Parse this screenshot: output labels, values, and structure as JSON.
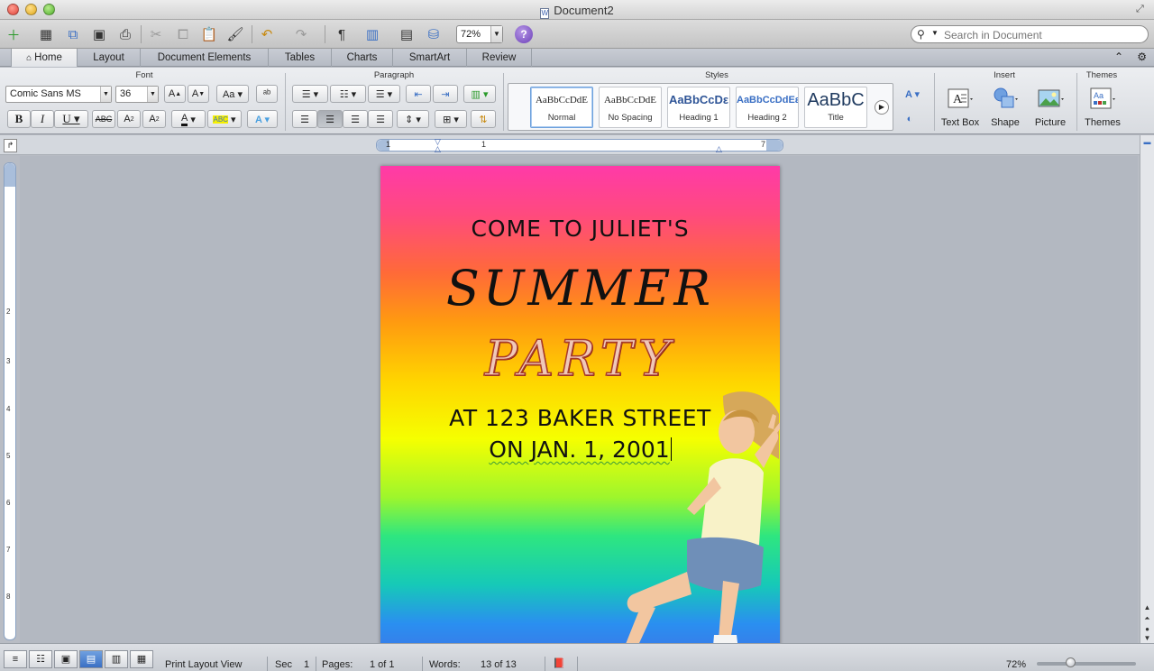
{
  "window": {
    "title": "Document2"
  },
  "toolbar": {
    "zoom": "72%",
    "search_placeholder": "Search in Document"
  },
  "ribbon_tabs": [
    "Home",
    "Layout",
    "Document Elements",
    "Tables",
    "Charts",
    "SmartArt",
    "Review"
  ],
  "ribbon": {
    "groups": {
      "font": "Font",
      "paragraph": "Paragraph",
      "styles": "Styles",
      "insert": "Insert",
      "themes": "Themes"
    },
    "font_name": "Comic Sans MS",
    "font_size": "36",
    "styles": [
      {
        "sample": "AaBbCcDdE",
        "name": "Normal"
      },
      {
        "sample": "AaBbCcDdE",
        "name": "No Spacing"
      },
      {
        "sample": "AaBbCcDε",
        "name": "Heading 1"
      },
      {
        "sample": "AaBbCcDdEε",
        "name": "Heading 2"
      },
      {
        "sample": "AaBbC",
        "name": "Title"
      }
    ],
    "insert": {
      "text_box": "Text Box",
      "shape": "Shape",
      "picture": "Picture"
    },
    "themes_label": "Themes"
  },
  "document": {
    "line1": "COME TO JULIET'S",
    "line2": "SUMMER",
    "line3": "PARTY",
    "line4": "AT 123 BAKER STREET",
    "line5": "ON JAN. 1, 2001"
  },
  "status": {
    "view": "Print Layout View",
    "sec_label": "Sec",
    "sec_value": "1",
    "pages_label": "Pages:",
    "pages_value": "1 of 1",
    "words_label": "Words:",
    "words_value": "13 of 13",
    "zoom": "72%"
  },
  "colors": {
    "accent": "#3a6fc4",
    "heading_blue": "#2f5597"
  }
}
